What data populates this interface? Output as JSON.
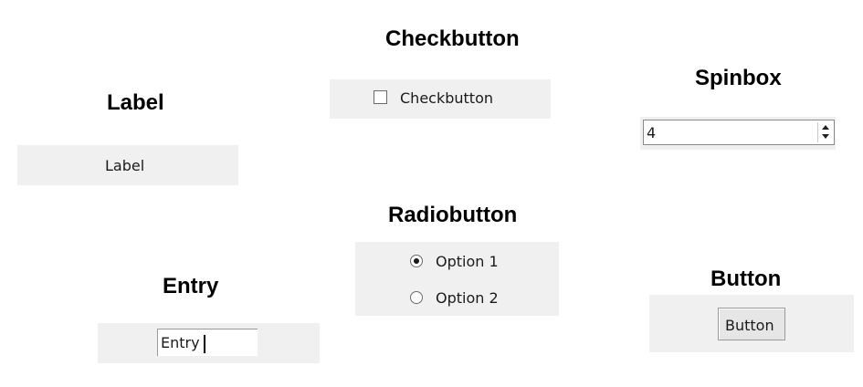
{
  "headings": {
    "label": "Label",
    "checkbutton": "Checkbutton",
    "spinbox": "Spinbox",
    "radiobutton": "Radiobutton",
    "entry": "Entry",
    "button": "Button"
  },
  "label_widget": {
    "text": "Label"
  },
  "checkbutton_widget": {
    "text": "Checkbutton",
    "checked": false
  },
  "spinbox_widget": {
    "value": "4"
  },
  "radiobutton_widget": {
    "options": [
      {
        "label": "Option 1",
        "selected": true
      },
      {
        "label": "Option 2",
        "selected": false
      }
    ]
  },
  "entry_widget": {
    "value": "Entry"
  },
  "button_widget": {
    "label": "Button"
  },
  "colors": {
    "panel_background": "#f0f0f0",
    "page_background": "#ffffff"
  }
}
